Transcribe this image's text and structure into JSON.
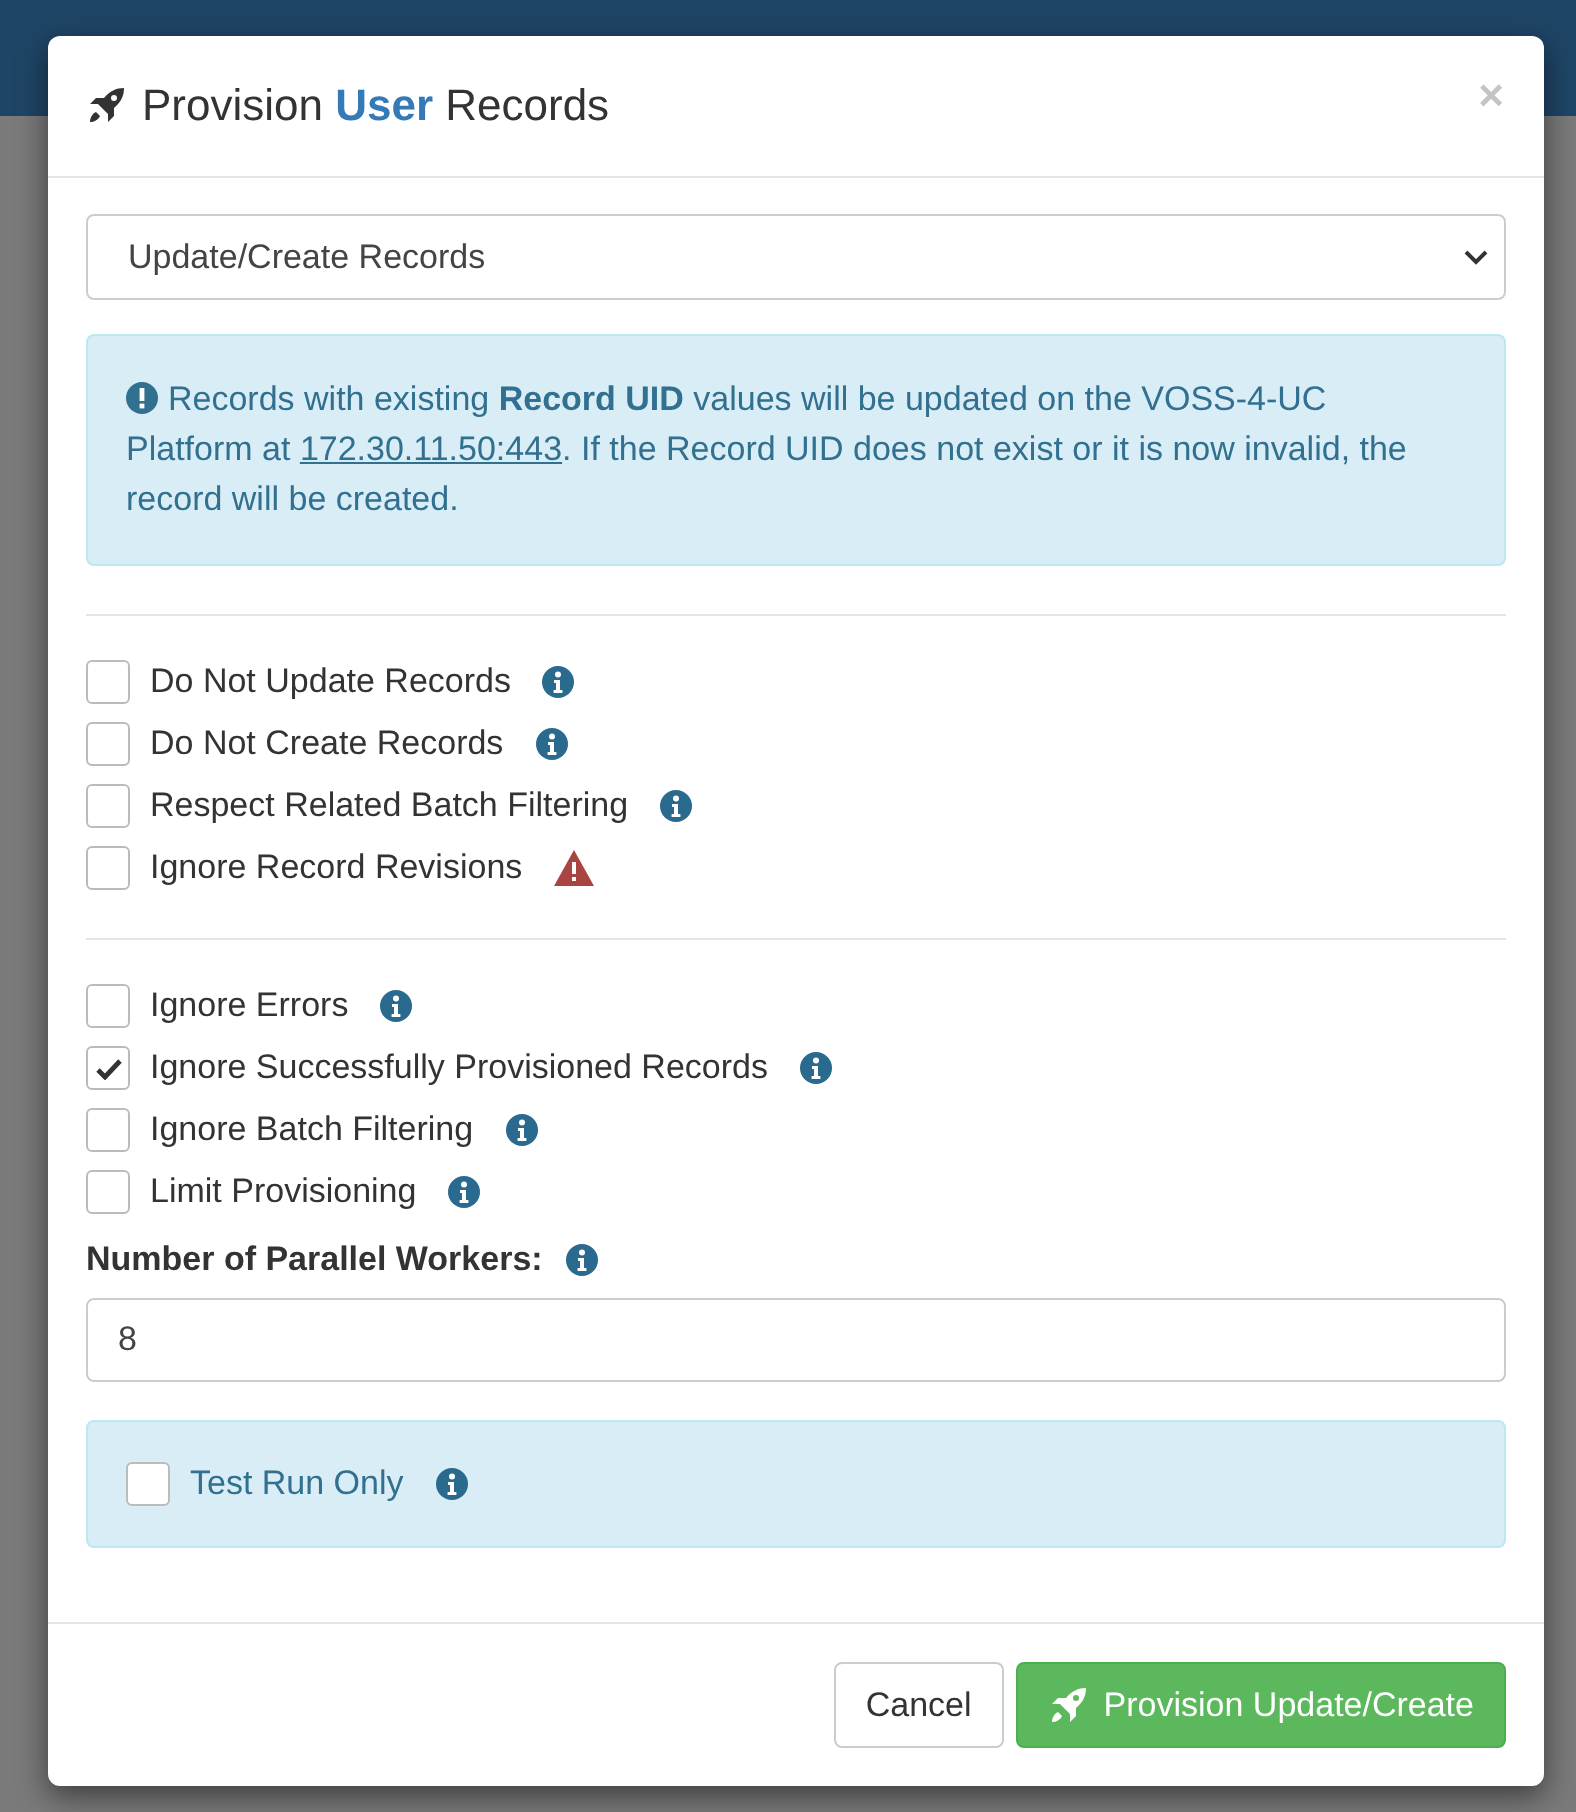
{
  "modal": {
    "title": "Provision **User** Records",
    "close": "×",
    "mode_select": {
      "value": "Update/Create Records"
    },
    "alert": {
      "before": "Records with existing **Record UID** values will be updated on the VOSS-4-UC Platform at",
      "link": "172.30.11.50:443",
      "after": ". If the Record UID does not exist or it is now invalid, the record will be created."
    },
    "option_groups": [
      [
        {
          "label": "Do Not Update Records",
          "checked": false,
          "kind": "info"
        },
        {
          "label": "Do Not Create Records",
          "checked": false,
          "kind": "info"
        },
        {
          "label": "Respect Related Batch Filtering",
          "checked": false,
          "kind": "info"
        },
        {
          "label": "Ignore Record Revisions",
          "checked": false,
          "kind": "warning"
        }
      ],
      [
        {
          "label": "Ignore Errors",
          "checked": false,
          "kind": "info"
        },
        {
          "label": "Ignore Successfully Provisioned Records",
          "checked": true,
          "kind": "info"
        },
        {
          "label": "Ignore Batch Filtering",
          "checked": false,
          "kind": "info"
        },
        {
          "label": "Limit Provisioning",
          "checked": false,
          "kind": "info"
        }
      ]
    ],
    "workers": {
      "label": "Number of Parallel Workers:",
      "value": "8"
    },
    "test_run": {
      "label": "Test Run Only",
      "checked": false
    },
    "buttons": [
      {
        "label": "Cancel",
        "kind": "default"
      },
      {
        "label": "Provision Update/Create",
        "kind": "primary"
      }
    ]
  }
}
